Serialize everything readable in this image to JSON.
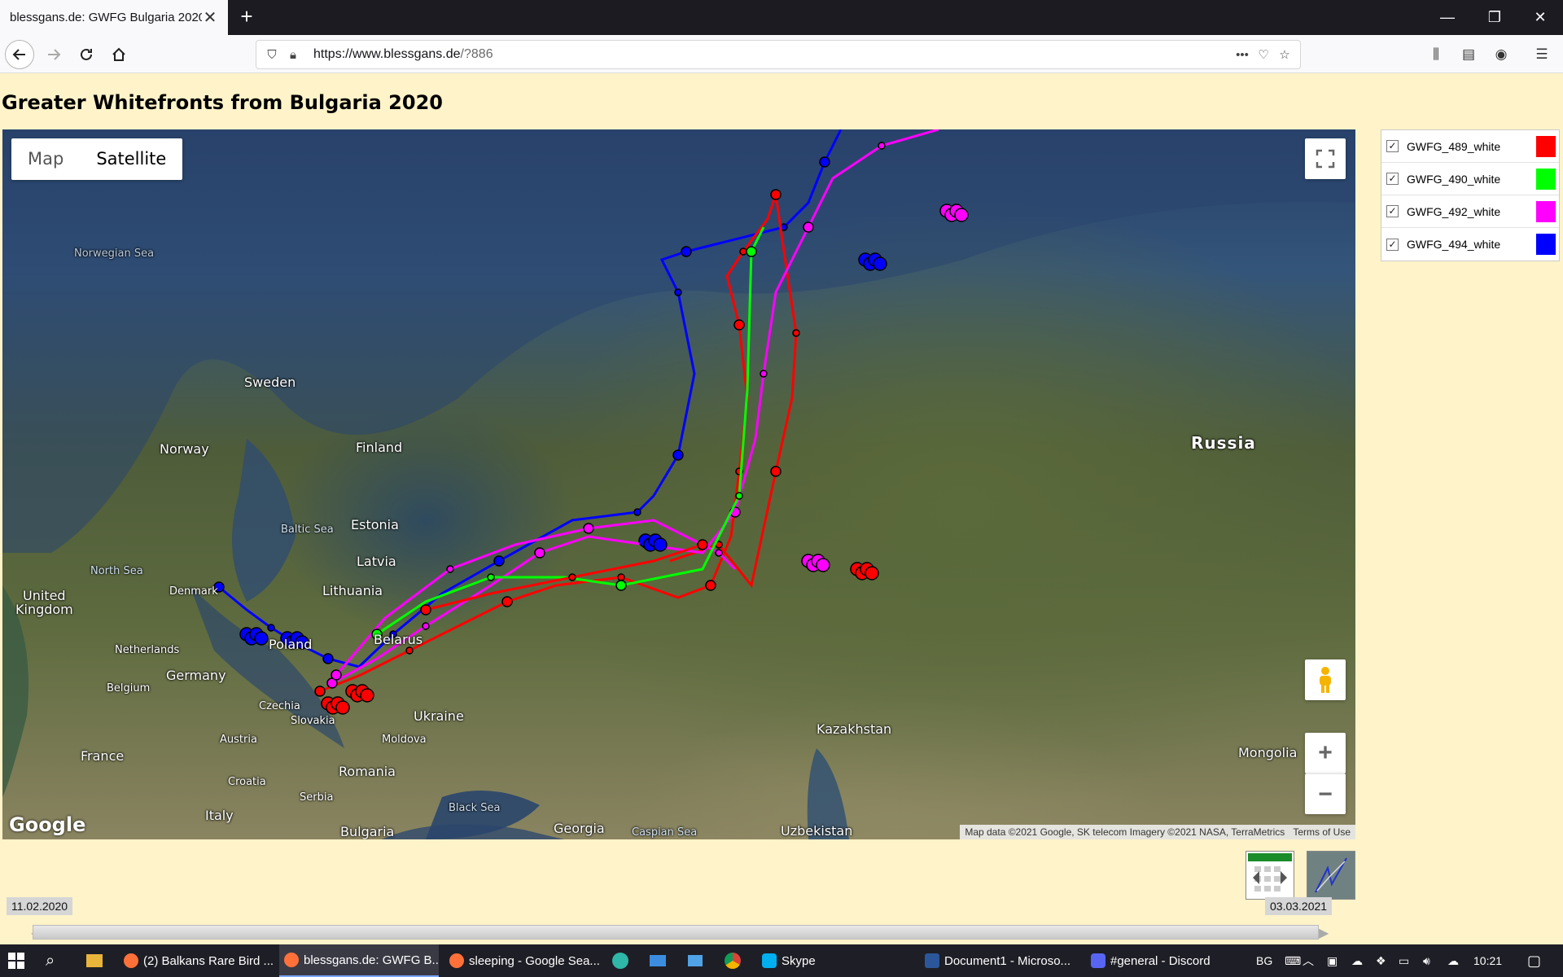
{
  "browser": {
    "tab_title": "blessgans.de: GWFG Bulgaria 2020",
    "url_host": "https://www.blessgans.de",
    "url_path": "/?886"
  },
  "page": {
    "title": "Greater Whitefronts from Bulgaria 2020"
  },
  "map": {
    "type_buttons": [
      "Map",
      "Satellite"
    ],
    "active_type": "Satellite",
    "attribution": "Map data ©2021 Google, SK telecom Imagery ©2021 NASA, TerraMetrics",
    "terms": "Terms of Use",
    "logo": "Google",
    "places": {
      "norwegian_sea": "Norwegian Sea",
      "sweden": "Sweden",
      "norway": "Norway",
      "finland": "Finland",
      "estonia": "Estonia",
      "baltic_sea": "Baltic Sea",
      "latvia": "Latvia",
      "north_sea": "North Sea",
      "denmark": "Denmark",
      "lithuania": "Lithuania",
      "united_kingdom_1": "United",
      "united_kingdom_2": "Kingdom",
      "netherlands": "Netherlands",
      "poland": "Poland",
      "belarus": "Belarus",
      "germany": "Germany",
      "belgium": "Belgium",
      "czechia": "Czechia",
      "slovakia": "Slovakia",
      "ukraine": "Ukraine",
      "austria": "Austria",
      "moldova": "Moldova",
      "france": "France",
      "croatia": "Croatia",
      "romania": "Romania",
      "serbia": "Serbia",
      "italy": "Italy",
      "black_sea": "Black Sea",
      "bulgaria": "Bulgaria",
      "georgia": "Georgia",
      "caspian_sea": "Caspian Sea",
      "uzbekistan": "Uzbekistan",
      "kazakhstan": "Kazakhstan",
      "russia": "Russia",
      "mongolia": "Mongolia"
    }
  },
  "legend": [
    {
      "label": "GWFG_489_white",
      "color": "#ff0000",
      "checked": true
    },
    {
      "label": "GWFG_490_white",
      "color": "#00ff00",
      "checked": true
    },
    {
      "label": "GWFG_492_white",
      "color": "#ff00ff",
      "checked": true
    },
    {
      "label": "GWFG_494_white",
      "color": "#0000ff",
      "checked": true
    }
  ],
  "timeline": {
    "start_date": "11.02.2020",
    "end_date": "03.03.2021"
  },
  "taskbar": {
    "items": [
      "(2) Balkans Rare Bird ...",
      "blessgans.de: GWFG B...",
      "sleeping - Google Sea...",
      "Skype",
      "Document1 - Microso...",
      "#general - Discord"
    ],
    "language": "BG",
    "time": "10:21"
  }
}
